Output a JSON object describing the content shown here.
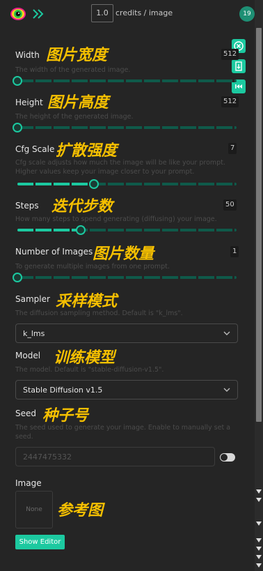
{
  "topbar": {
    "credit_value": "1.0",
    "credit_text": "credits / image",
    "user_badge": "19"
  },
  "fields": {
    "width": {
      "label": "Width",
      "overlay": "图片宽度",
      "description": "The width of the generated image.",
      "value": "512",
      "slider_fraction": 0.0
    },
    "height": {
      "label": "Height",
      "overlay": "图片高度",
      "description": "The height of the generated image.",
      "value": "512",
      "slider_fraction": 0.0
    },
    "cfg": {
      "label": "Cfg Scale",
      "overlay": "扩散强度",
      "description": "Cfg scale adjusts how much the image will be like your prompt. Higher values keep your image closer to your prompt.",
      "value": "7",
      "slider_fraction": 0.35
    },
    "steps": {
      "label": "Steps",
      "overlay": "迭代步数",
      "description": "How many steps to spend generating (diffusing) your image.",
      "value": "50",
      "slider_fraction": 0.29
    },
    "num_images": {
      "label": "Number of Images",
      "overlay": "图片数量",
      "description": "To generate multiple images from one prompt.",
      "value": "1",
      "slider_fraction": 0.0
    },
    "sampler": {
      "label": "Sampler",
      "overlay": "采样模式",
      "description": "The diffusion sampling method. Default is \"k_lms\".",
      "selected": "k_lms"
    },
    "model": {
      "label": "Model",
      "overlay": "训练模型",
      "description": "The model. Default is \"stable-diffusion-v1.5\".",
      "selected": "Stable Diffusion v1.5"
    },
    "seed": {
      "label": "Seed",
      "overlay": "种子号",
      "description": "The seed used to generate your image. Enable to manually set a seed.",
      "placeholder": "2447475332"
    },
    "image": {
      "label": "Image",
      "overlay": "参考图",
      "box_text": "None",
      "button": "Show Editor"
    }
  },
  "colors": {
    "accent": "#1cc9a0",
    "overlay_text": "#f6c000",
    "background": "#252525"
  },
  "icons": [
    "eye-logo-icon",
    "double-chevron-icon",
    "close-circle-icon",
    "download-icon",
    "skip-back-icon",
    "chevron-down-icon"
  ]
}
